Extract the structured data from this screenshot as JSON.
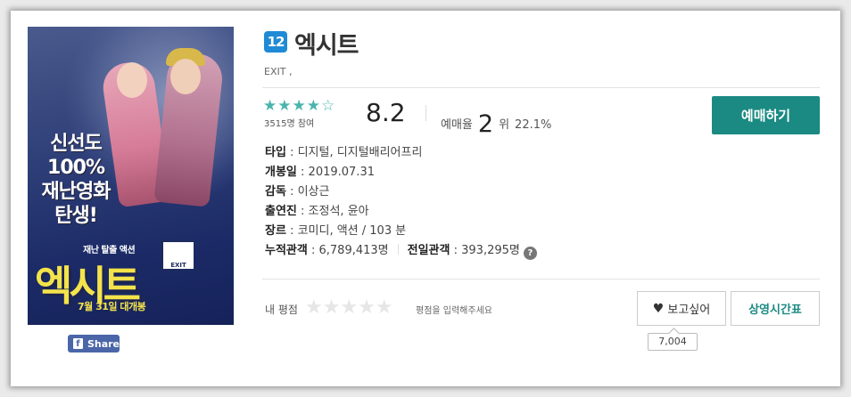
{
  "movie": {
    "age_rating": "12",
    "title": "엑시트",
    "english_title": "EXIT ,"
  },
  "poster": {
    "tagline": [
      "신선도",
      "100%",
      "재난영화",
      "탄생!"
    ],
    "subtitle": "재난 탈출 액션",
    "exit_sign": "EXIT",
    "title": "엑시트",
    "release_banner": "7월 31일 대개봉"
  },
  "share": {
    "label": "Share",
    "icon": "facebook-icon"
  },
  "rating": {
    "stars_text": "★★★★☆",
    "star_value": 4,
    "participants": "3515명 참여",
    "score": "8.2",
    "reservation_label": "예매율",
    "reservation_rank": "2",
    "reservation_rank_suffix": "위",
    "reservation_percent": "22.1%"
  },
  "booking": {
    "label": "예매하기"
  },
  "details": {
    "type_label": "타입",
    "type_value": "디지털, 디지털배리어프리",
    "release_label": "개봉일",
    "release_value": "2019.07.31",
    "director_label": "감독",
    "director_value": "이상근",
    "cast_label": "출연진",
    "cast_value": "조정석, 윤아",
    "genre_label": "장르",
    "genre_value": "코미디, 액션 / 103 분",
    "cumulative_label": "누적관객",
    "cumulative_value": "6,789,413명",
    "previous_day_label": "전일관객",
    "previous_day_value": "393,295명"
  },
  "my_rating": {
    "label": "내 평점",
    "stars_text": "★★★★★",
    "hint": "평점을 입력해주세요"
  },
  "actions": {
    "wish_label": "보고싶어",
    "wish_count": "7,004",
    "schedule_label": "상영시간표"
  },
  "colors": {
    "accent": "#1b8a82",
    "star": "#4ab4ad",
    "age_badge": "#1f8ad6",
    "facebook": "#4a66a8"
  }
}
